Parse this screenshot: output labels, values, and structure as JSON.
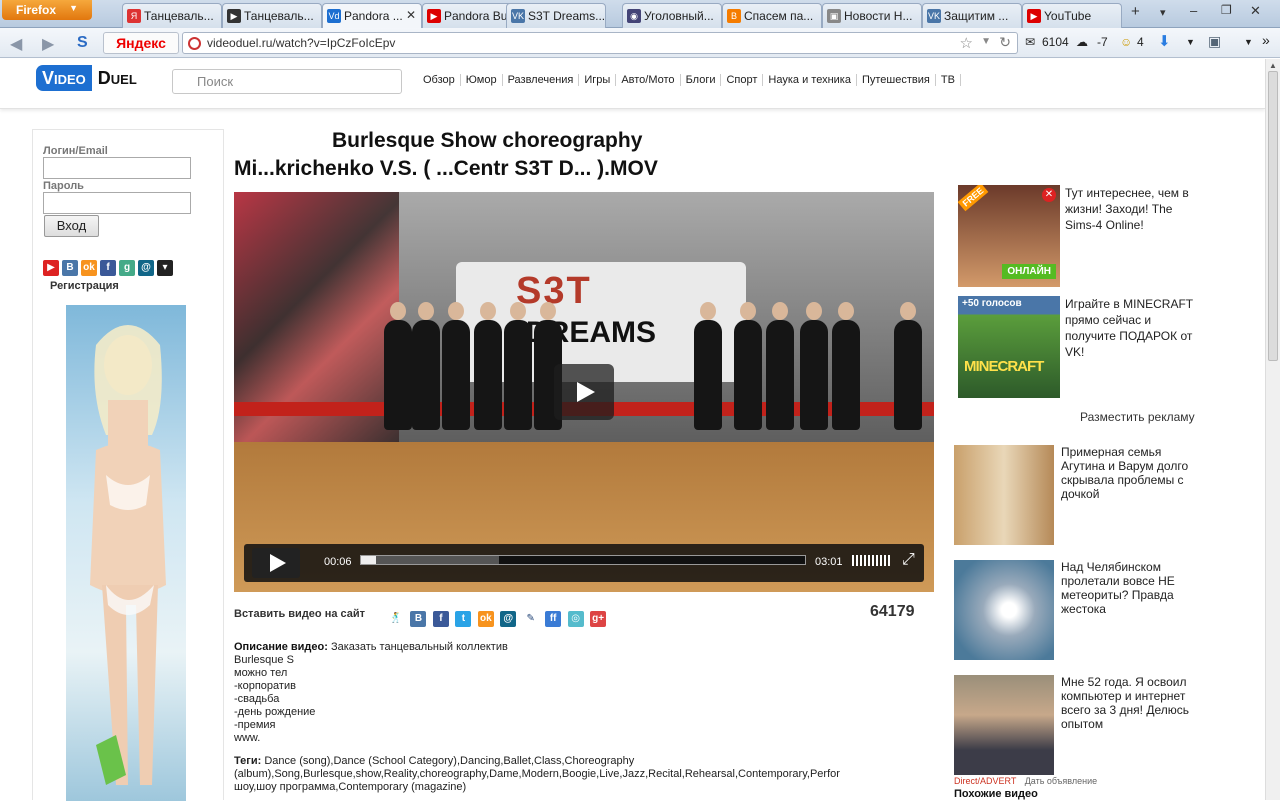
{
  "browser": {
    "menu_button": "Firefox",
    "tabs": [
      {
        "label": "Танцеваль...",
        "icon_text": "Я",
        "color": "#d33"
      },
      {
        "label": "Танцеваль...",
        "icon_text": "▶",
        "color": "#333"
      },
      {
        "label": "Pandora ...",
        "icon_text": "Vd",
        "color": "#1d6fd1"
      },
      {
        "label": "Pandora Bu...",
        "icon_text": "▶",
        "color": "#d00"
      },
      {
        "label": "S3T Dreams...",
        "icon_text": "VK",
        "color": "#4a76a8"
      },
      {
        "label": "Уголовный...",
        "icon_text": "◉",
        "color": "#447"
      },
      {
        "label": "Спасем па...",
        "icon_text": "B",
        "color": "#f57c00"
      },
      {
        "label": "Новости Н...",
        "icon_text": "▣",
        "color": "#888"
      },
      {
        "label": "Защитим ...",
        "icon_text": "VK",
        "color": "#4a76a8"
      },
      {
        "label": "YouTube",
        "icon_text": "▶",
        "color": "#d00"
      }
    ],
    "yandex_label": "Яндекс",
    "url": "videoduel.ru/watch?v=IpCzFoIcEpv",
    "mail_count": "6104",
    "weather": "-7",
    "notif_count": "4"
  },
  "site": {
    "logo_video": "Video",
    "logo_duel": "Duel",
    "search_placeholder": "Поиск",
    "categories": [
      "Обзор",
      "Юмор",
      "Развлечения",
      "Игры",
      "Авто/Мото",
      "Блоги",
      "Спорт",
      "Наука и техника",
      "Путешествия",
      "ТВ"
    ]
  },
  "login": {
    "login_label": "Логин/Email",
    "password_label": "Пароль",
    "submit_label": "Вход",
    "register_label": "Регистрация",
    "social_icons": [
      {
        "name": "youtube-icon",
        "glyph": "▶",
        "color": "#d22"
      },
      {
        "name": "vk-icon",
        "glyph": "B",
        "color": "#4a76a8"
      },
      {
        "name": "odnoklassniki-icon",
        "glyph": "ok",
        "color": "#f7931e"
      },
      {
        "name": "facebook-icon",
        "glyph": "f",
        "color": "#3b5998"
      },
      {
        "name": "google-icon",
        "glyph": "g",
        "color": "#4a8"
      },
      {
        "name": "mail-ru-icon",
        "glyph": "@",
        "color": "#168"
      },
      {
        "name": "dropdown-icon",
        "glyph": "▾",
        "color": "#222"
      }
    ]
  },
  "video": {
    "title_line1": "Burlesque Show choreography",
    "title_line2": "Mi...kricheнko V.S. ( ...Centr S3T D... ).MOV",
    "current_time": "00:06",
    "duration": "03:01",
    "progress_fraction": 0.033,
    "buffered_fraction": 0.31,
    "views": "64179",
    "embed_label": "Вставить видео на сайт"
  },
  "description": {
    "label": "Описание видео:",
    "first_line": "Заказать танцевальный коллектив",
    "lines": [
      "Burlesque S",
      "можно тел",
      "-корпоратив",
      "-свадьба",
      "-день рождение",
      "-премия",
      "www."
    ]
  },
  "tags": {
    "label": "Теги:",
    "text": "Dance (song),Dance (School Category),Dancing,Ballet,Class,Choreography (album),Song,Burlesque,show,Reality,choreography,Dame,Modern,Boogie,Live,Jazz,Recital,Rehearsal,Contemporary,Perfor шоу,шоу программа,Contemporary (magazine)"
  },
  "ads": [
    {
      "text": "Тут интереснее, чем в жизни! Заходи! The Sims-4 Online!",
      "badge": "FREE",
      "cta": "ОНЛАЙН"
    },
    {
      "text": "Играйте в MINECRAFT прямо сейчас и получите ПОДАРОК от VK!",
      "badge": "+50 голосов",
      "cta": "MINECRAFT"
    }
  ],
  "place_ad_label": "Разместить рекламу",
  "news": [
    {
      "text": "Примерная семья Агутина и Варум долго скрывала проблемы с дочкой"
    },
    {
      "text": "Над Челябинском пролетали вовсе НЕ метеориты? Правда жестока"
    },
    {
      "text": "Мне 52 года. Я освоил компьютер и интернет всего за 3 дня! Делюсь опытом"
    }
  ],
  "direct": {
    "brand": "Direct/ADVERT",
    "link": "Дать объявление"
  },
  "similar_label": "Похожие видео"
}
